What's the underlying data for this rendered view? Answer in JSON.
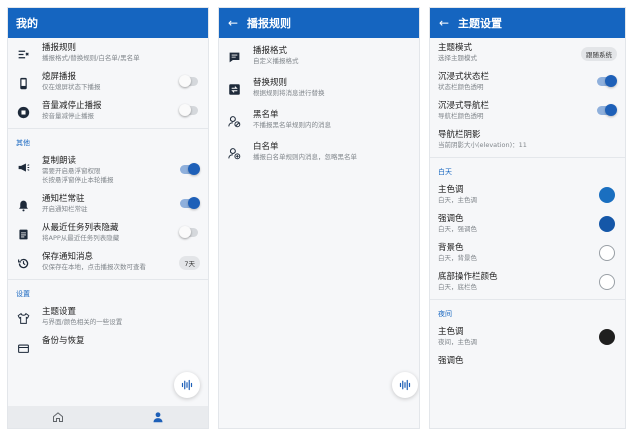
{
  "p1": {
    "title": "我的",
    "items1": [
      {
        "title": "播报规则",
        "sub": "播报格式/替换规则/白名单/黑名单"
      },
      {
        "title": "熄屏播报",
        "sub": "仅在熄屏状态下播报"
      },
      {
        "title": "音量减停止播报",
        "sub": "按音量减停止播报"
      }
    ],
    "section_other": "其他",
    "items2": [
      {
        "title": "复制朗读",
        "sub": "需要开启悬浮窗权限",
        "sub2": "长按悬浮窗停止本轮播报"
      },
      {
        "title": "通知栏常驻",
        "sub": "开启通知栏常驻"
      },
      {
        "title": "从最近任务列表隐藏",
        "sub": "将APP从最近任务列表隐藏"
      },
      {
        "title": "保存通知消息",
        "sub": "仅保存在本地，点击播报次数可查看",
        "chip": "7天"
      }
    ],
    "section_settings": "设置",
    "items3": [
      {
        "title": "主题设置",
        "sub": "与界面/颜色相关的一些设置"
      },
      {
        "title": "备份与恢复"
      }
    ]
  },
  "p2": {
    "title": "播报规则",
    "items": [
      {
        "title": "播报格式",
        "sub": "自定义播报格式"
      },
      {
        "title": "替换规则",
        "sub": "根据规则将消息进行替换"
      },
      {
        "title": "黑名单",
        "sub": "不播报黑名单规则内的消息"
      },
      {
        "title": "白名单",
        "sub": "播报白名单规则内消息，忽略黑名单"
      }
    ]
  },
  "p3": {
    "title": "主题设置",
    "items": [
      {
        "title": "主题模式",
        "sub": "选择主题模式",
        "chip": "跟随系统"
      },
      {
        "title": "沉浸式状态栏",
        "sub": "状态栏颜色透明"
      },
      {
        "title": "沉浸式导航栏",
        "sub": "导航栏颜色透明"
      },
      {
        "title": "导航栏阴影",
        "sub": "当前阴影大小(elevation)：11"
      }
    ],
    "section_light": "白天",
    "light": [
      {
        "title": "主色调",
        "sub": "白天，主色调"
      },
      {
        "title": "强调色",
        "sub": "白天，强调色"
      },
      {
        "title": "背景色",
        "sub": "白天，背景色"
      },
      {
        "title": "底部操作栏颜色",
        "sub": "白天，底栏色"
      }
    ],
    "section_night": "夜间",
    "night": [
      {
        "title": "主色调",
        "sub": "夜间，主色调"
      },
      {
        "title": "强调色"
      }
    ]
  },
  "colors": {
    "appbar": "#1565c0",
    "primary_light": "#1a6fc0",
    "accent_light": "#1557a8",
    "primary_night": "#1f1f1f"
  }
}
